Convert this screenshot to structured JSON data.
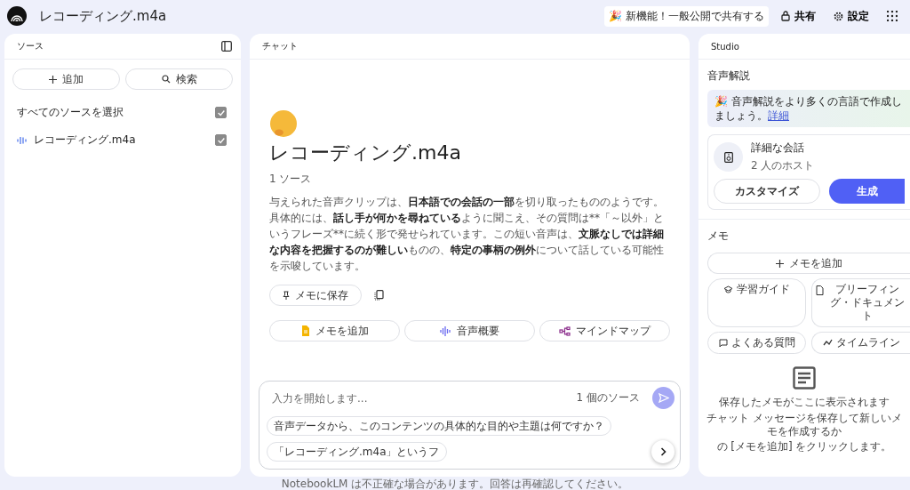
{
  "header": {
    "title": "レコーディング.m4a",
    "announcement": "🎉 新機能！一般公開で共有する",
    "share": "共有",
    "settings": "設定"
  },
  "sources": {
    "title": "ソース",
    "add": "追加",
    "search": "検索",
    "select_all": {
      "label": "すべてのソースを選択",
      "checked": true
    },
    "items": [
      {
        "name": "レコーディング.m4a",
        "checked": true
      }
    ]
  },
  "chat": {
    "title": "チャット",
    "notebook_title": "レコーディング.m4a",
    "source_count": "1 ソース",
    "summary": [
      {
        "text": "与えられた音声クリップは、",
        "bold": false
      },
      {
        "text": "日本語での会話の一部",
        "bold": true
      },
      {
        "text": "を切り取ったもののようです。具体的には、",
        "bold": false
      },
      {
        "text": "話し手が何かを尋ねている",
        "bold": true
      },
      {
        "text": "ように聞こえ、その質問は**「～以外」というフレーズ**に続く形で発せられています。この短い音声は、",
        "bold": false
      },
      {
        "text": "文脈なしでは詳細な内容を把握するのが難しい",
        "bold": true
      },
      {
        "text": "ものの、",
        "bold": false
      },
      {
        "text": "特定の事柄の例外",
        "bold": true
      },
      {
        "text": "について話している可能性を示唆しています。",
        "bold": false
      }
    ],
    "save_to_memo": "メモに保存",
    "actions": [
      {
        "kind": "note",
        "label": "メモを追加"
      },
      {
        "kind": "audio",
        "label": "音声概要"
      },
      {
        "kind": "mindmap",
        "label": "マインドマップ"
      }
    ],
    "input": {
      "placeholder": "入力を開始します...",
      "source_count": "1 個のソース"
    },
    "suggestions": [
      "音声データから、このコンテンツの具体的な目的や主題は何ですか？",
      "「レコーディング.m4a」というフ"
    ],
    "footer": "NotebookLM は不正確な場合があります。回答は再確認してください。"
  },
  "studio": {
    "title": "Studio",
    "audio_title": "音声解説",
    "banner": "🎉 音声解説をより多くの言語で作成しましょう。",
    "banner_link": "詳細",
    "audio_card": {
      "title": "詳細な会話",
      "subtitle": "2 人のホスト",
      "customize": "カスタマイズ",
      "generate": "生成"
    },
    "memo_title": "メモ",
    "add_memo": "メモを追加",
    "memo_buttons": [
      {
        "kind": "guide",
        "label": "学習ガイド"
      },
      {
        "kind": "doc",
        "label": "ブリーフィング・ドキュメント"
      },
      {
        "kind": "faq",
        "label": "よくある質問"
      },
      {
        "kind": "timeline",
        "label": "タイムライン"
      }
    ],
    "empty_title": "保存したメモがここに表示されます",
    "empty_lines": [
      "チャット メッセージを保存して新しいメモを作成するか",
      "の [メモを追加] をクリックします。"
    ]
  }
}
